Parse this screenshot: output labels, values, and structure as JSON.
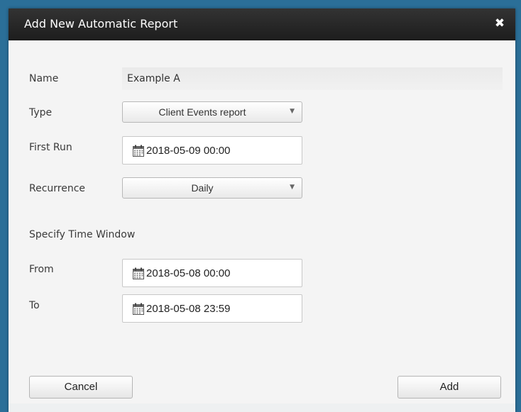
{
  "dialog": {
    "title": "Add New Automatic Report",
    "close_icon": "close-icon",
    "close_glyph": "✖"
  },
  "form": {
    "name": {
      "label": "Name",
      "value": "Example A"
    },
    "type": {
      "label": "Type",
      "value": "Client Events report",
      "caret": "▼"
    },
    "first_run": {
      "label": "First Run",
      "value": "2018-05-09 00:00",
      "icon": "calendar-icon"
    },
    "recurrence": {
      "label": "Recurrence",
      "value": "Daily",
      "caret": "▼"
    },
    "time_window": {
      "heading": "Specify Time Window",
      "from": {
        "label": "From",
        "value": "2018-05-08 00:00",
        "icon": "calendar-icon"
      },
      "to": {
        "label": "To",
        "value": "2018-05-08 23:59",
        "icon": "calendar-icon"
      }
    }
  },
  "actions": {
    "cancel_label": "Cancel",
    "add_label": "Add"
  },
  "colors": {
    "titlebar": "#262626",
    "frame": "#2b6f98",
    "dialog_bg": "#f4f4f4"
  }
}
